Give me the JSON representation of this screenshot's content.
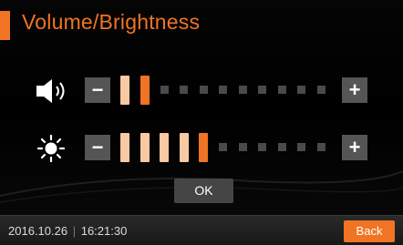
{
  "header": {
    "title": "Volume/Brightness"
  },
  "volume": {
    "icon": "speaker-icon",
    "minus_label": "−",
    "plus_label": "+",
    "level": 2,
    "total_steps": 11
  },
  "brightness": {
    "icon": "sun-icon",
    "minus_label": "−",
    "plus_label": "+",
    "level": 5,
    "total_steps": 11
  },
  "ok_label": "OK",
  "footer": {
    "date": "2016.10.26",
    "separator": "|",
    "time": "16:21:30",
    "back_label": "Back"
  },
  "colors": {
    "accent": "#f07423",
    "segment_on_light": "#f8c9a3",
    "segment_on_last": "#f07423",
    "segment_off": "#4a4a4a"
  }
}
